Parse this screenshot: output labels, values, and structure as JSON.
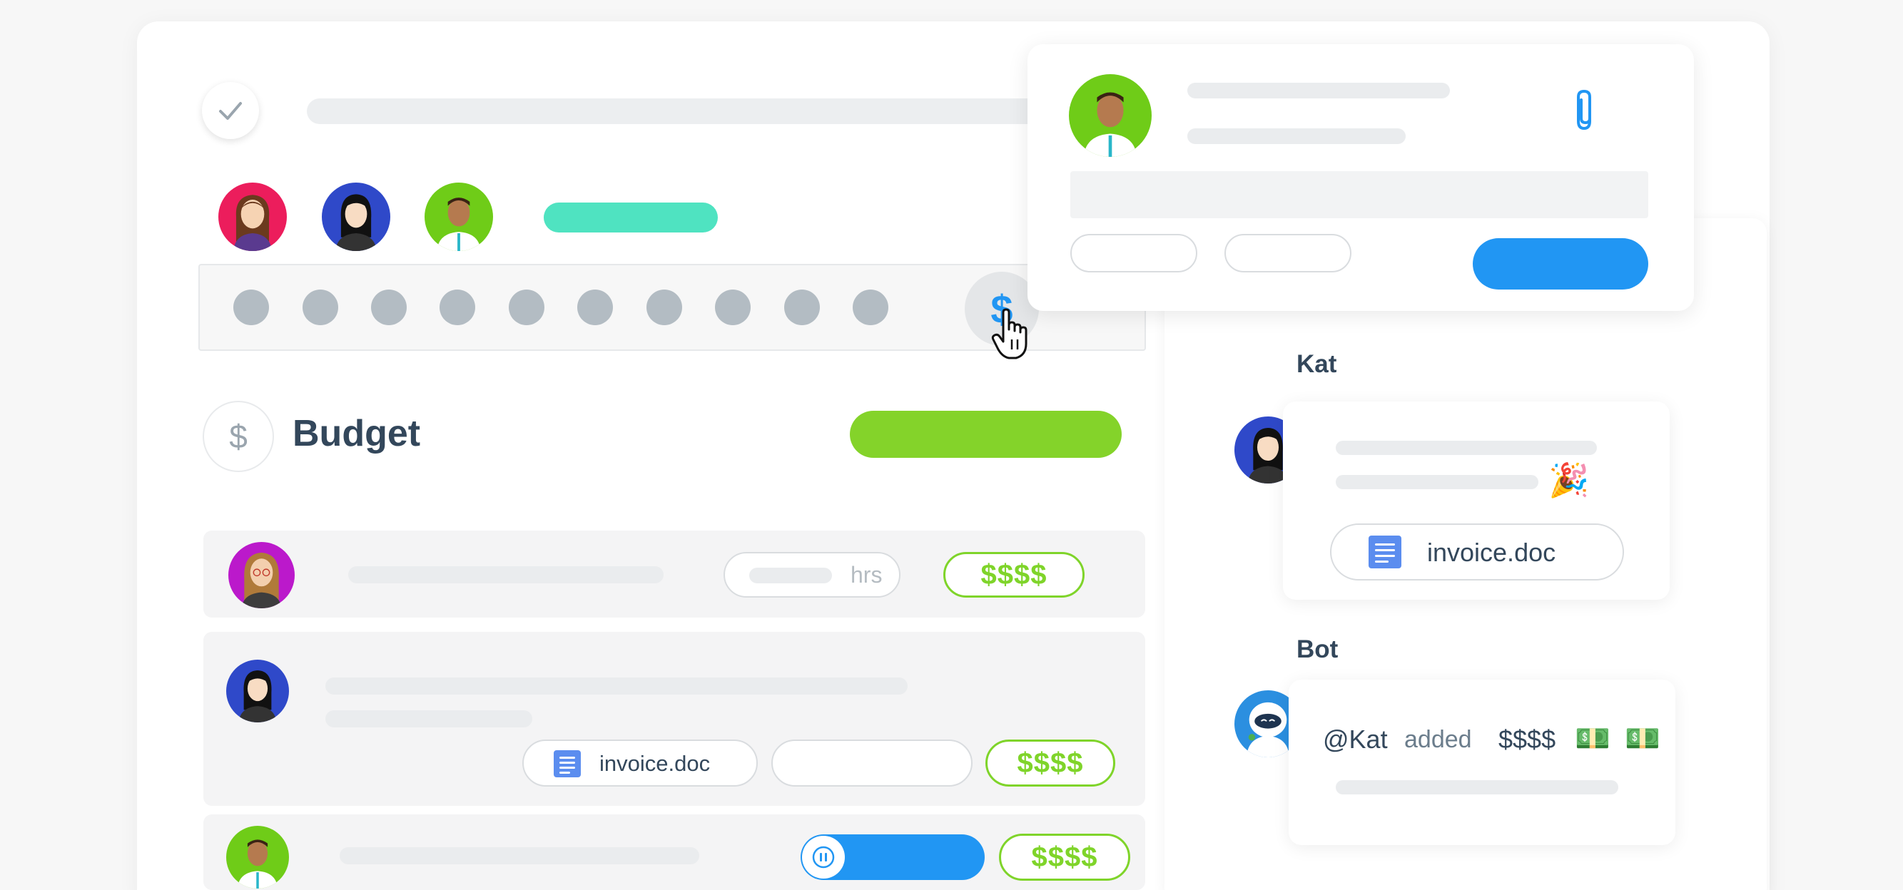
{
  "budget": {
    "title": "Budget",
    "dollar_icon": "$",
    "rows": [
      {
        "hours_unit": "hrs",
        "amount": "$$$$"
      },
      {
        "attachment": "invoice.doc",
        "amount": "$$$$"
      },
      {
        "amount": "$$$$"
      }
    ]
  },
  "toolbar": {
    "dollar_button": "$"
  },
  "chat": {
    "messages": [
      {
        "author": "Kat",
        "emoji": "🎉",
        "attachment": "invoice.doc"
      },
      {
        "author": "Bot",
        "mention": "@Kat",
        "verb": "added",
        "amount": "$$$$",
        "emoji1": "💵",
        "emoji2": "💵"
      }
    ]
  },
  "colors": {
    "accent_blue": "#2196f3",
    "accent_green": "#84d32a",
    "accent_teal": "#4fe3c1",
    "avatar_red": "#ec1d5c",
    "avatar_blue": "#2f49c9",
    "avatar_green": "#6fcc18",
    "avatar_purple": "#bb19cb"
  }
}
